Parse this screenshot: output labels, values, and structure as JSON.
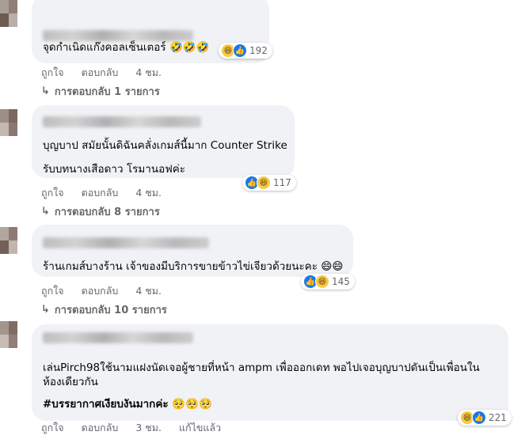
{
  "comments": [
    {
      "text_lines": [
        "จุดกำเนิดแก๊งคอลเซ็นเตอร์ 🤣🤣🤣"
      ],
      "reactions": [
        "haha",
        "like"
      ],
      "reaction_count": "192",
      "like_label": "ถูกใจ",
      "reply_label": "ตอบกลับ",
      "time": "4 ชม.",
      "replies_label": "การตอบกลับ 1 รายการ"
    },
    {
      "text_lines": [
        "บุญบาป สมัยนั้นดิฉันคลั่งเกมส์นี้มาก Counter Strike",
        "รับบทนางเสือดาว โรมานอฟค่ะ"
      ],
      "reactions": [
        "like",
        "haha"
      ],
      "reaction_count": "117",
      "like_label": "ถูกใจ",
      "reply_label": "ตอบกลับ",
      "time": "4 ชม.",
      "replies_label": "การตอบกลับ 8 รายการ"
    },
    {
      "text_lines": [
        "ร้านเกมส์บางร้าน เจ้าของมีบริการขายข้าวไข่เจียวด้วยนะคะ 😄😄"
      ],
      "reactions": [
        "like",
        "haha"
      ],
      "reaction_count": "145",
      "like_label": "ถูกใจ",
      "reply_label": "ตอบกลับ",
      "time": "4 ชม.",
      "replies_label": "การตอบกลับ 10 รายการ"
    },
    {
      "text_lines": [
        "เล่นPirch98ใช้นามแฝงนัดเจอผู้ชายที่หน้า ampm เพื่อออกเดท พอไปเจอบุญบาปดันเป็นเพื่อนใน",
        "ห้องเดียวกัน",
        "#บรรยากาศเงียบงันมากค่ะ 🥺🥺🥺"
      ],
      "reactions": [
        "haha",
        "like"
      ],
      "reaction_count": "221",
      "like_label": "ถูกใจ",
      "reply_label": "ตอบกลับ",
      "time": "3 ชม.",
      "edited_label": "แก้ไขแล้ว"
    }
  ],
  "icons": {
    "reply_arrow": "reply-arrow-icon",
    "like": "like-reaction-icon",
    "haha": "haha-reaction-icon"
  },
  "colors": {
    "bubble": "#f0f2f5",
    "meta_text": "#65676b",
    "like_blue": "#1877f2",
    "haha_yellow": "#f7c948"
  }
}
